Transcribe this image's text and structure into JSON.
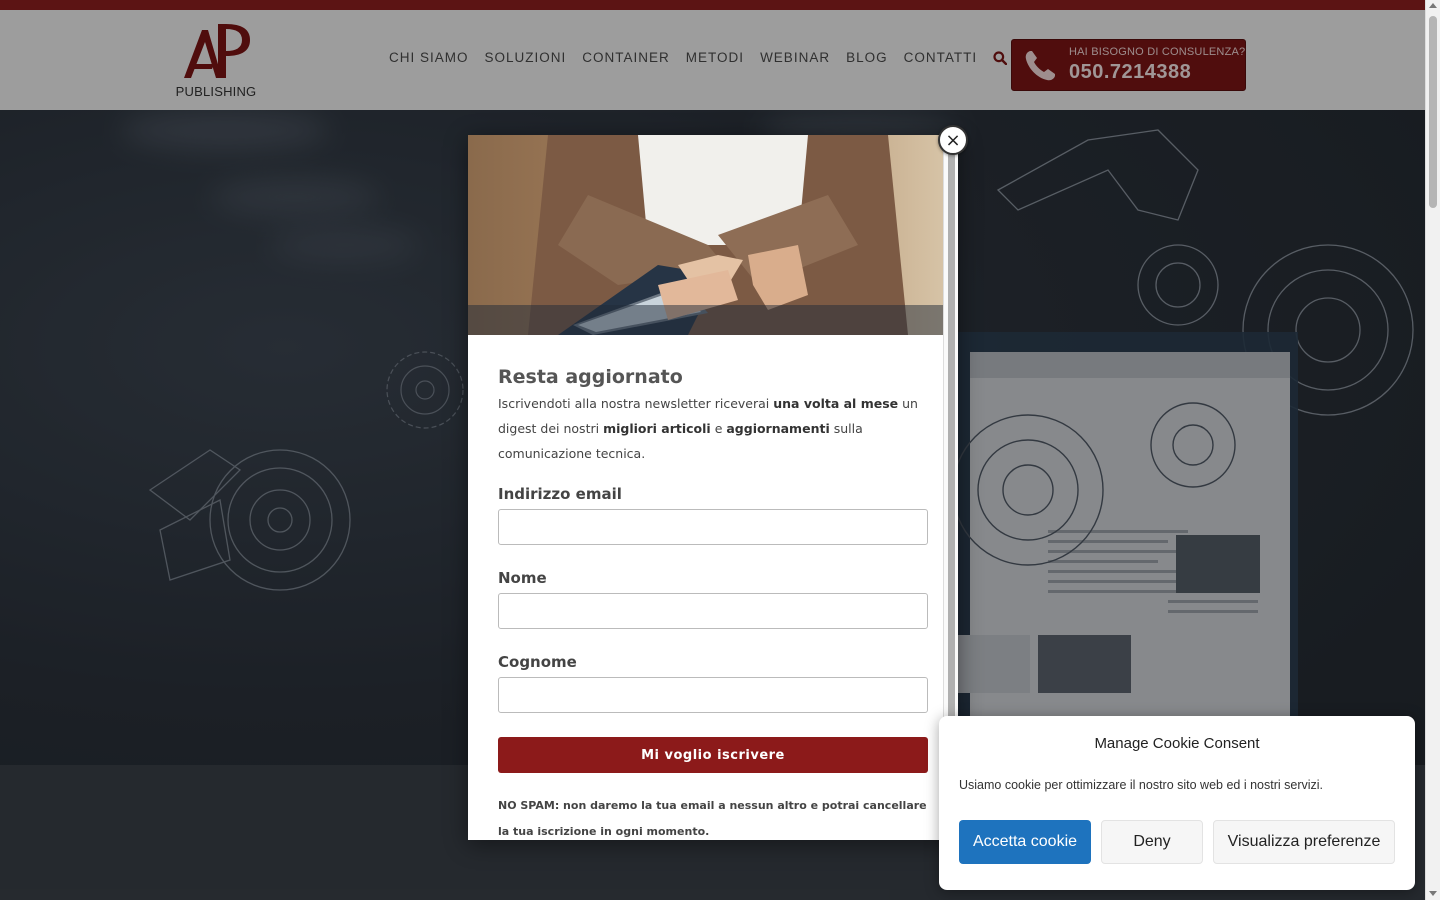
{
  "header": {
    "logo_text": "PUBLISHING",
    "logo_mark": "AP",
    "nav": [
      "CHI SIAMO",
      "SOLUZIONI",
      "CONTAINER",
      "METODI",
      "WEBINAR",
      "BLOG",
      "CONTATTI"
    ],
    "search_icon": "search-icon",
    "cta": {
      "label": "HAI BISOGNO DI CONSULENZA?",
      "phone": "050.7214388",
      "icon": "phone-icon"
    }
  },
  "newsletter": {
    "title": "Resta aggiornato",
    "desc": {
      "p1": "Iscrivendoti alla nostra newsletter riceverai ",
      "b1": "una volta al mese",
      "p2": " un digest dei nostri ",
      "b2": "migliori articoli",
      "p3": " e ",
      "b3": "aggiornamenti",
      "p4": " sulla comunicazione tecnica."
    },
    "fields": {
      "email": {
        "label": "Indirizzo email",
        "value": ""
      },
      "nome": {
        "label": "Nome",
        "value": ""
      },
      "cognome": {
        "label": "Cognome",
        "value": ""
      }
    },
    "submit": "Mi voglio iscrivere",
    "nospam": "NO SPAM: non daremo la tua email a nessun altro e potrai cancellare la tua iscrizione in ogni momento.",
    "close": "×"
  },
  "cookie": {
    "title": "Manage Cookie Consent",
    "text": "Usiamo cookie per ottimizzare il nostro sito web ed i nostri servizi.",
    "accept": "Accetta cookie",
    "deny": "Deny",
    "prefs": "Visualizza preferenze"
  },
  "colors": {
    "brand": "#7b1515",
    "submit": "#8c1a1a",
    "accept": "#1e73be"
  }
}
